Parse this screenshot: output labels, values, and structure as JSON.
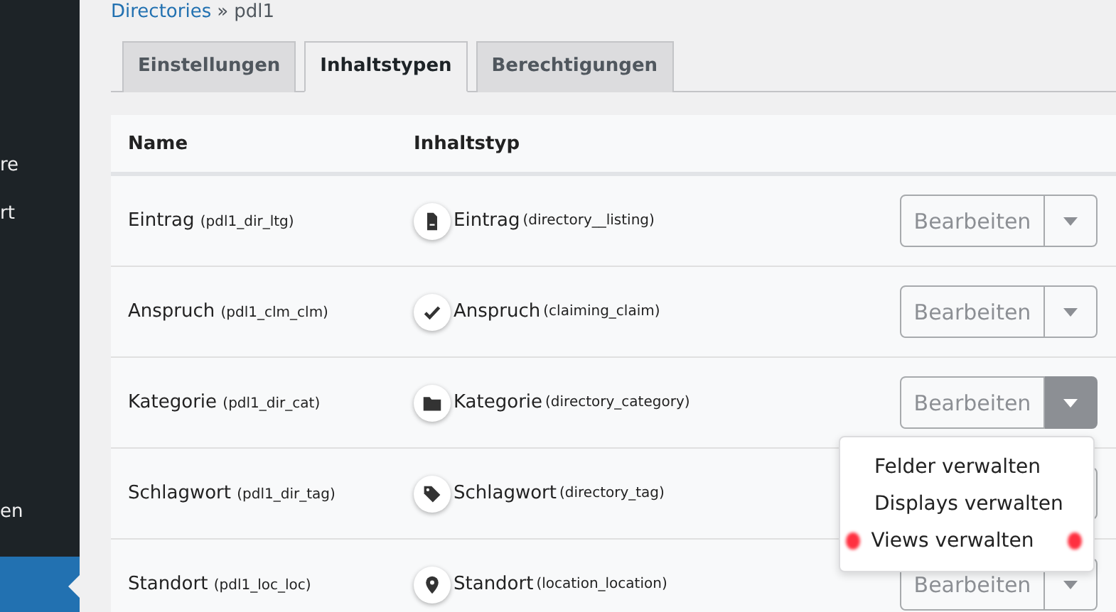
{
  "sidebar": {
    "items": [
      {
        "label": "re",
        "selected": false
      },
      {
        "label": "rt",
        "selected": false
      },
      {
        "label": "en",
        "selected": false
      },
      {
        "selected": true
      }
    ]
  },
  "breadcrumb": {
    "link": "Directories",
    "separator": "»",
    "current": "pdl1"
  },
  "tabs": [
    {
      "label": "Einstellungen",
      "selected": false
    },
    {
      "label": "Inhaltstypen",
      "selected": true
    },
    {
      "label": "Berechtigungen",
      "selected": false
    }
  ],
  "table": {
    "columns": [
      "Name",
      "Inhaltstyp"
    ],
    "rows": [
      {
        "name": "Eintrag",
        "slug": "(pdl1_dir_ltg)",
        "kind": "document",
        "type": "Eintrag",
        "type_slug": "(directory__listing)",
        "button": "Bearbeiten",
        "menu_open": false
      },
      {
        "name": "Anspruch",
        "slug": "(pdl1_clm_clm)",
        "kind": "check",
        "type": "Anspruch",
        "type_slug": "(claiming_claim)",
        "button": "Bearbeiten",
        "menu_open": false
      },
      {
        "name": "Kategorie",
        "slug": "(pdl1_dir_cat)",
        "kind": "folder",
        "type": "Kategorie",
        "type_slug": "(directory_category)",
        "button": "Bearbeiten",
        "menu_open": true
      },
      {
        "name": "Schlagwort",
        "slug": "(pdl1_dir_tag)",
        "kind": "tag",
        "type": "Schlagwort",
        "type_slug": "(directory_tag)",
        "menu_open": false
      },
      {
        "name": "Standort",
        "slug": "(pdl1_loc_loc)",
        "kind": "pin",
        "type": "Standort",
        "type_slug": "(location_location)",
        "button": "Bearbeiten",
        "menu_open": false
      }
    ]
  },
  "menu": {
    "items": [
      {
        "label": "Felder verwalten",
        "highlighted": false
      },
      {
        "label": "Displays verwalten",
        "highlighted": false
      },
      {
        "label": "Views verwalten",
        "highlighted": true
      }
    ]
  }
}
